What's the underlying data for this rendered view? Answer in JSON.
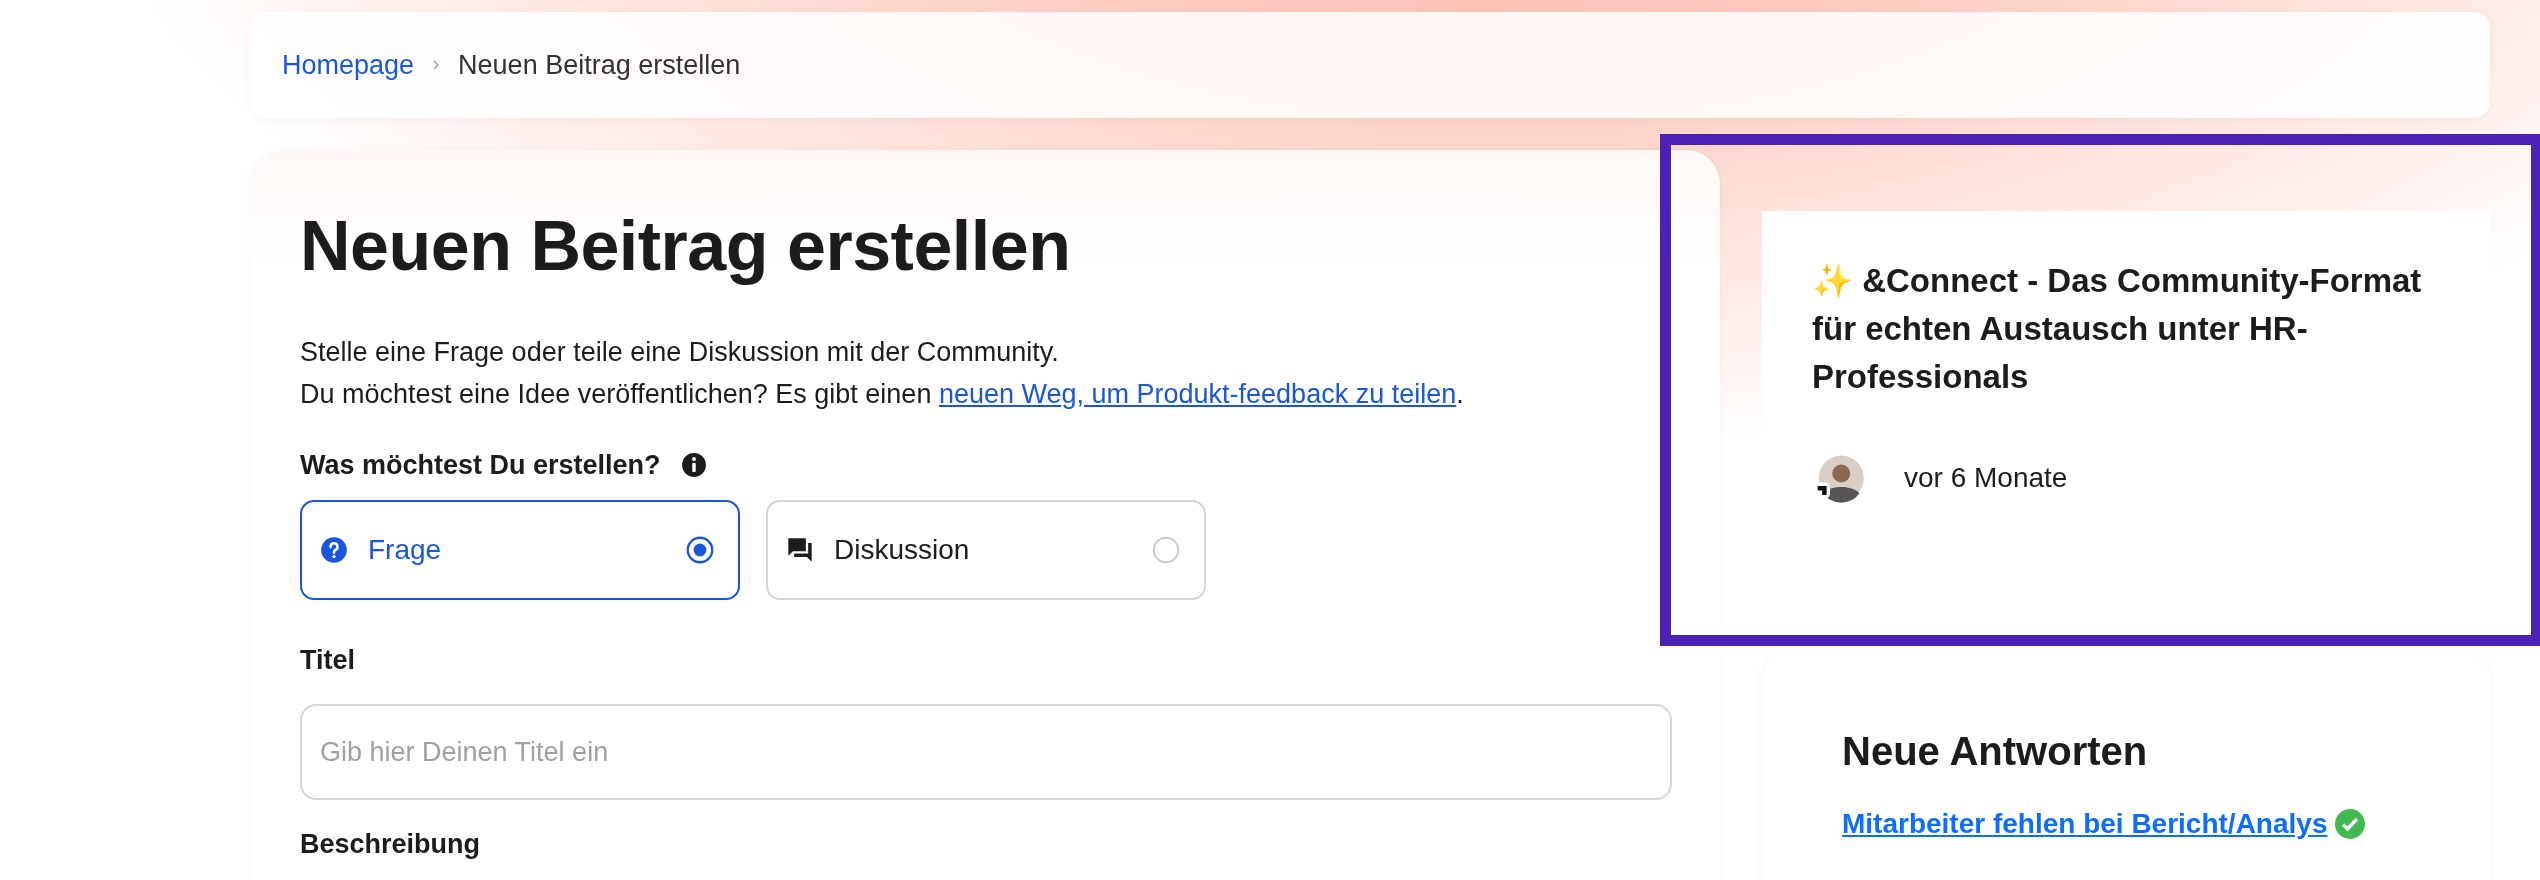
{
  "breadcrumb": [
    {
      "label": "Homepage",
      "kind": "link"
    },
    {
      "label": "Neuen Beitrag erstellen",
      "kind": "current"
    }
  ],
  "form": {
    "heading": "Neuen Beitrag erstellen",
    "intro": [
      "Stelle eine Frage oder teile eine Diskussion mit der Community."
    ],
    "idea_line": {
      "text": "Du möchtest eine Idee veröffentlichen? Es gibt einen ",
      "link": "neuen Weg, um Produkt-feedback zu teilen",
      "after": "."
    },
    "type_label": "Was möchtest Du erstellen?",
    "types": [
      {
        "label": "Frage",
        "kind": "question",
        "selected": true
      },
      {
        "label": "Diskussion",
        "kind": "discussion",
        "selected": false
      }
    ],
    "title_label": "Titel",
    "title_field": {
      "placeholder": "Gib hier Deinen Titel ein"
    },
    "description_label": "Beschreibung"
  },
  "featured_post": {
    "highlighted": true,
    "title": "✨ &Connect - Das Community-Format für echten Austausch unter HR-Professionals",
    "time": "vor 6 Monate"
  },
  "new_answers": {
    "heading": "Neue Antworten",
    "items": [
      {
        "title": "Mitarbeiter fehlen bei Bericht/Analys",
        "solved": true
      }
    ]
  }
}
